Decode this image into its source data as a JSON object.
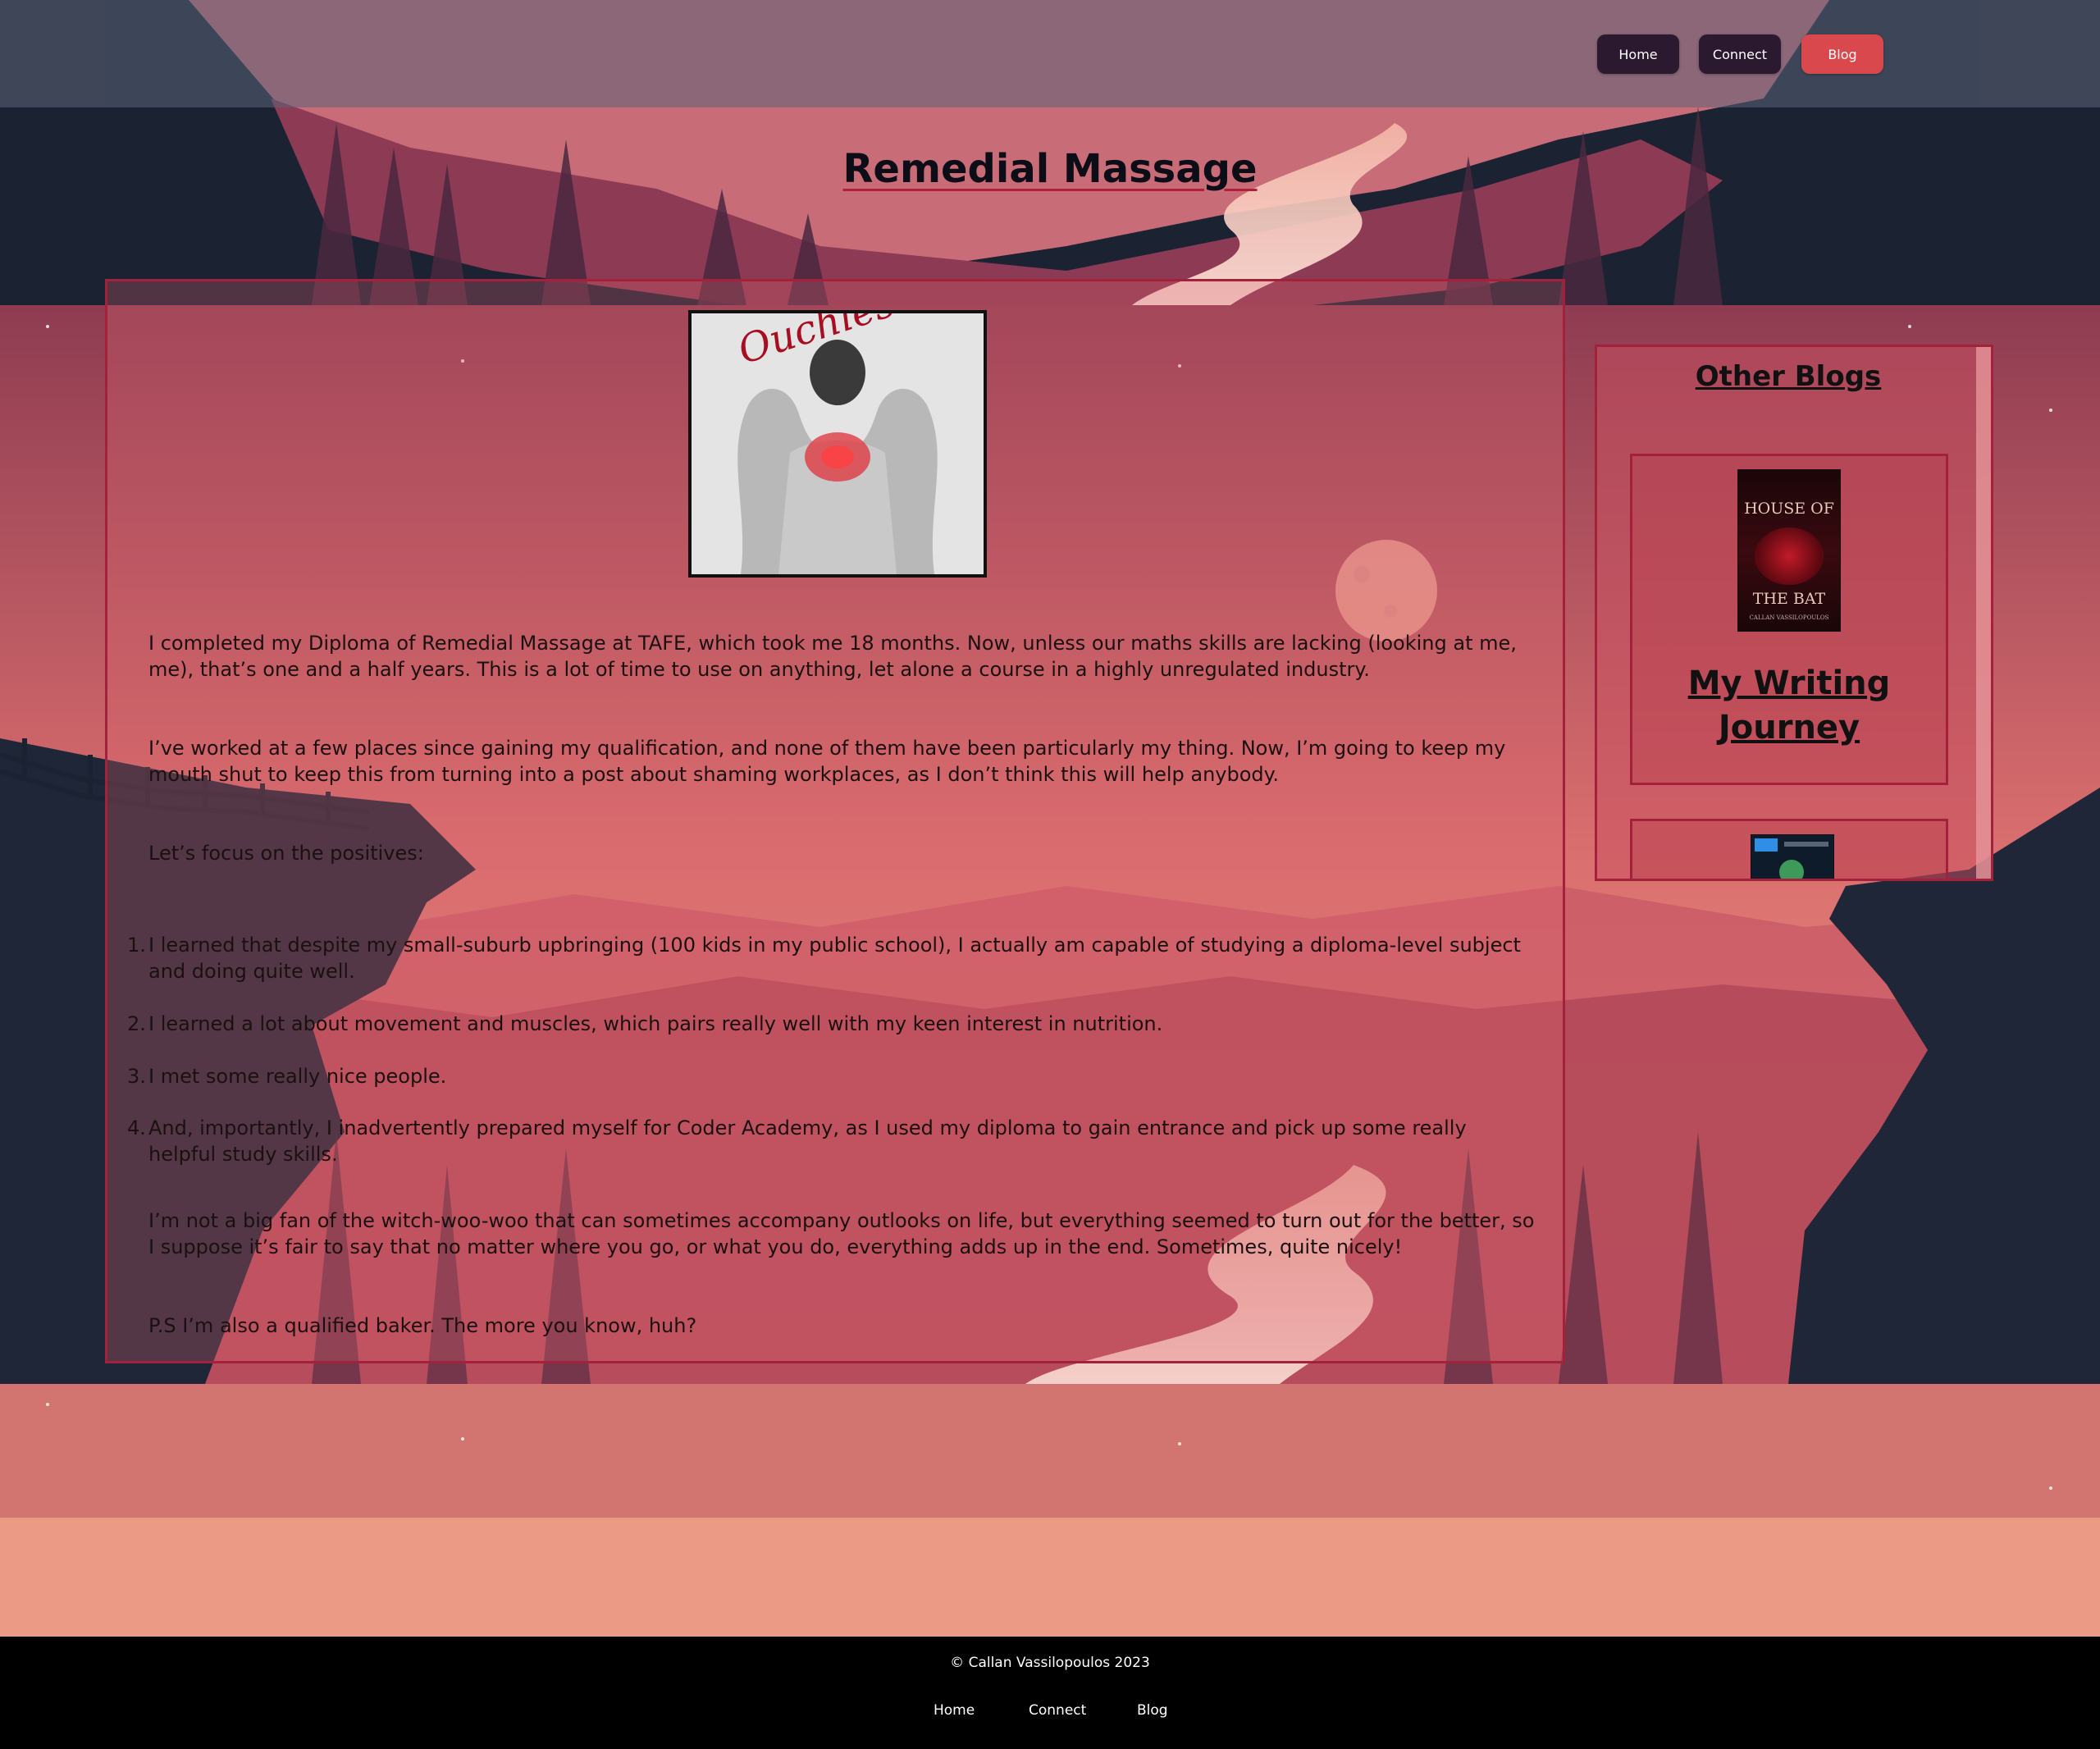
{
  "nav": {
    "home": "Home",
    "connect": "Connect",
    "blog": "Blog"
  },
  "page": {
    "title": "Remedial Massage"
  },
  "article": {
    "image_caption": "Ouchies!!!",
    "paragraphs": [
      "I completed my Diploma of Remedial Massage at TAFE, which took me 18 months. Now, unless our maths skills are lacking (looking at me, me), that’s one and a half years. This is a lot of time to use on anything, let alone a course in a highly unregulated industry.",
      "I’ve worked at a few places since gaining my qualification, and none of them have been particularly my thing. Now, I’m going to keep my mouth shut to keep this from turning into a post about shaming workplaces, as I don’t think this will help anybody.",
      "Let’s focus on the positives:"
    ],
    "list": [
      "I learned that despite my small-suburb upbringing (100 kids in my public school), I actually am capable of studying a diploma-level subject and doing quite well.",
      "I learned a lot about movement and muscles, which pairs really well with my keen interest in nutrition.",
      "I met some really nice people.",
      "And, importantly, I inadvertently prepared myself for Coder Academy, as I used my diploma to gain entrance and pick up some really helpful study skills."
    ],
    "closing": [
      "I’m not a big fan of the witch-woo-woo that can sometimes accompany outlooks on life, but everything seemed to turn out for the better, so I suppose it’s fair to say that no matter where you go, or what you do, everything adds up in the end. Sometimes, quite nicely!",
      "P.S I’m also a qualified baker. The more you know, huh?"
    ]
  },
  "sidebar": {
    "title": "Other Blogs",
    "cards": [
      {
        "title": "My Writing Journey",
        "cover_text_top": "HOUSE OF",
        "cover_text_bottom": "THE BAT",
        "cover_author": "CALLAN VASSILOPOULOS"
      }
    ]
  },
  "footer": {
    "copyright": "© Callan Vassilopoulos 2023",
    "home": "Home",
    "connect": "Connect",
    "blog": "Blog"
  },
  "colors": {
    "accent": "#d8484d",
    "nav_dark": "#2b1930",
    "border": "#a3213b"
  }
}
